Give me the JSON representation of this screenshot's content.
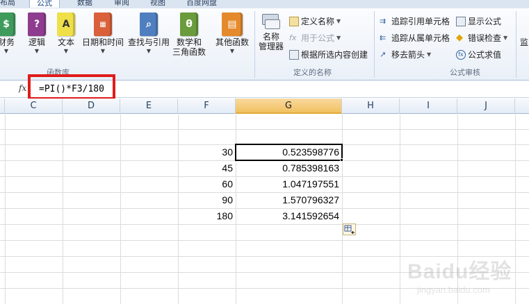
{
  "tabs": [
    {
      "label": "页面布局"
    },
    {
      "label": "公式"
    },
    {
      "label": "数据"
    },
    {
      "label": "审阅"
    },
    {
      "label": "视图"
    },
    {
      "label": "百度网盘"
    }
  ],
  "function_library": {
    "label": "函数库",
    "buttons": [
      {
        "label": "财务"
      },
      {
        "label": "逻辑"
      },
      {
        "label": "文本"
      },
      {
        "label": "日期和时间"
      },
      {
        "label": "查找与引用"
      },
      {
        "label": "数学和",
        "label2": "三角函数"
      },
      {
        "label": "其他函数"
      }
    ]
  },
  "defined_names": {
    "label": "定义的名称",
    "name_manager": {
      "label": "名称",
      "label2": "管理器"
    },
    "define_name": "定义名称",
    "use_in_formula": "用于公式",
    "create_from_selection": "根据所选内容创建"
  },
  "formula_auditing": {
    "label": "公式审核",
    "trace_precedents": "追踪引用单元格",
    "trace_dependents": "追踪从属单元格",
    "remove_arrows": "移去箭头",
    "show_formulas": "显示公式",
    "error_checking": "错误检查",
    "evaluate_formula": "公式求值",
    "watch_window": "监"
  },
  "formula_bar": {
    "fx": "fx",
    "formula": "=PI()*F3/180"
  },
  "columns": [
    "C",
    "D",
    "E",
    "F",
    "G",
    "H",
    "I",
    "J"
  ],
  "selected_column": "G",
  "rows": [
    {
      "f": "30",
      "g": "0.523598776"
    },
    {
      "f": "45",
      "g": "0.785398163"
    },
    {
      "f": "60",
      "g": "1.047197551"
    },
    {
      "f": "90",
      "g": "1.570796327"
    },
    {
      "f": "180",
      "g": "3.141592654"
    }
  ],
  "watermark": {
    "main": "Baidu经验",
    "sub": "jingyan.baidu.com"
  },
  "colors": {
    "highlight_box": "#e01b1b",
    "selected_header": "#f1c15f",
    "ribbon_bg": "#eaf0f8"
  }
}
